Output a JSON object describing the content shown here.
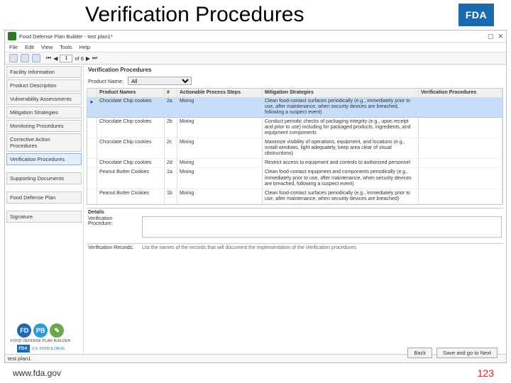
{
  "slide": {
    "title": "Verification Procedures",
    "fda_badge": "FDA",
    "footer_url": "www.fda.gov",
    "page_number": "123"
  },
  "window": {
    "title": "Food Defense Plan Builder - test plan1*",
    "maximize": "▢",
    "close": "✕"
  },
  "menu": [
    "File",
    "Edit",
    "View",
    "Tools",
    "Help"
  ],
  "toolbar": {
    "page_value": "1",
    "page_of": "of 8",
    "first": "⏮",
    "prev": "◀",
    "next": "▶",
    "last": "⏭"
  },
  "sidebar": {
    "items": [
      "Facility Information",
      "Product Description",
      "Vulnerability Assessments",
      "Mitigation Strategies",
      "Monitoring Procedures",
      "Corrective Action Procedures",
      "Verification Procedures",
      "Supporting Documents",
      "Food Defense Plan",
      "Signature"
    ],
    "active_index": 6
  },
  "main": {
    "section_title": "Verification Procedures",
    "filter_label": "Product Name:",
    "filter_value": "All"
  },
  "grid": {
    "headers": [
      "",
      "Product Names",
      "#",
      "Actionable Process Steps",
      "Mitigation Strategies",
      "Verification Procedures"
    ],
    "rows": [
      {
        "arrow": "▸",
        "product": "Chocolate Chip cookies",
        "num": "2a",
        "step": "Mixing",
        "mit": "Clean food-contact surfaces periodically (e.g., immediately prior to use, after maintenance, when security devices are breached, following a suspect event)",
        "ver": "",
        "selected": true
      },
      {
        "arrow": "",
        "product": "Chocolate Chip cookies",
        "num": "2b",
        "step": "Mixing",
        "mit": "Conduct periodic checks of packaging integrity (e.g., upon receipt and prior to use) including for packaged products, ingredients, and equipment components",
        "ver": ""
      },
      {
        "arrow": "",
        "product": "Chocolate Chip cookies",
        "num": "2c",
        "step": "Mixing",
        "mit": "Maximize visibility of operations, equipment, and locations (e.g., install windows, light adequately, keep area clear of visual obstructions)",
        "ver": ""
      },
      {
        "arrow": "",
        "product": "Chocolate Chip cookies",
        "num": "2d",
        "step": "Mixing",
        "mit": "Restrict access to equipment and controls to authorized personnel",
        "ver": ""
      },
      {
        "arrow": "",
        "product": "Peanut Butter Cookies",
        "num": "1a",
        "step": "Mixing",
        "mit": "Clean food-contact equipment and components periodically (e.g., immediately prior to use, after maintenance, when security devices are breached, following a suspect event)",
        "ver": ""
      },
      {
        "arrow": "",
        "product": "Peanut Butter Cookies",
        "num": "1b",
        "step": "Mixing",
        "mit": "Clean food-contact surfaces periodically (e.g., immediately prior to use, after maintenance, when security devices are breached)",
        "ver": ""
      }
    ]
  },
  "details": {
    "header": "Details",
    "proc_label": "Verification Procedure:",
    "records_label": "Verification Records:",
    "records_hint": "List the names of the records that will document the implementation of the Verification procedures"
  },
  "buttons": {
    "back": "Back",
    "next": "Save and go to Next"
  },
  "status": {
    "tab": "test plan1"
  },
  "logos": {
    "b1": "FD",
    "b2": "PB",
    "b3": "✎",
    "strip_text": "FOOD DEFENSE PLAN BUILDER",
    "fda_small": "FDA",
    "fda_small_text": "U.S. FOOD & DRUG"
  }
}
